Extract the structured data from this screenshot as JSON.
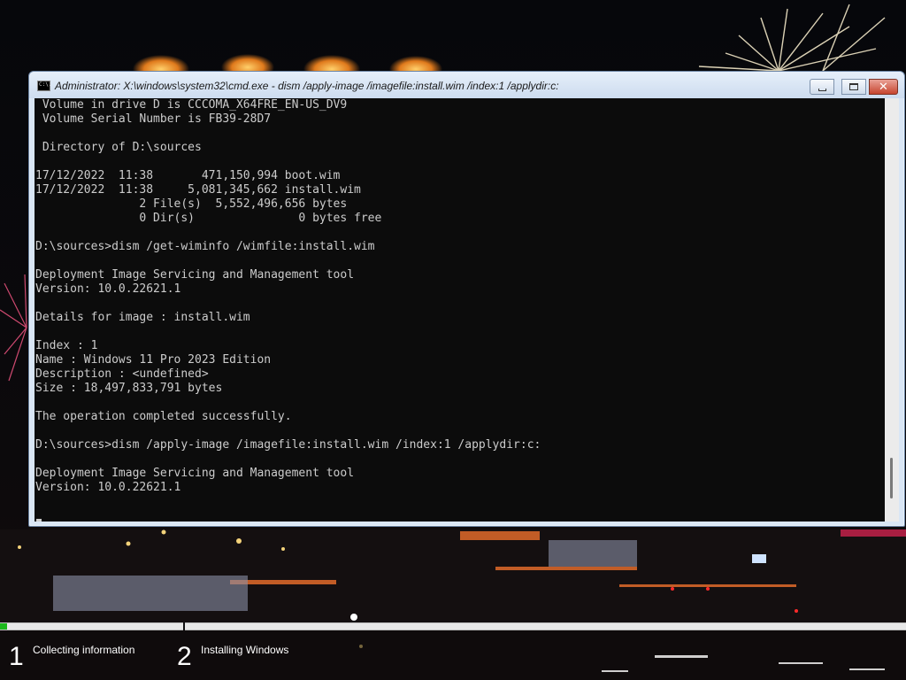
{
  "window": {
    "title": "Administrator: X:\\windows\\system32\\cmd.exe - dism  /apply-image /imagefile:install.wim /index:1 /applydir:c:",
    "icon": "cmd-icon",
    "icon_text": "C:\\."
  },
  "console": {
    "lines": [
      " Volume in drive D is CCCOMA_X64FRE_EN-US_DV9",
      " Volume Serial Number is FB39-28D7",
      "",
      " Directory of D:\\sources",
      "",
      "17/12/2022  11:38       471,150,994 boot.wim",
      "17/12/2022  11:38     5,081,345,662 install.wim",
      "               2 File(s)  5,552,496,656 bytes",
      "               0 Dir(s)               0 bytes free",
      "",
      "D:\\sources>dism /get-wiminfo /wimfile:install.wim",
      "",
      "Deployment Image Servicing and Management tool",
      "Version: 10.0.22621.1",
      "",
      "Details for image : install.wim",
      "",
      "Index : 1",
      "Name : Windows 11 Pro 2023 Edition",
      "Description : <undefined>",
      "Size : 18,497,833,791 bytes",
      "",
      "The operation completed successfully.",
      "",
      "D:\\sources>dism /apply-image /imagefile:install.wim /index:1 /applydir:c:",
      "",
      "Deployment Image Servicing and Management tool",
      "Version: 10.0.22621.1"
    ],
    "text_color": "#cccccc",
    "background": "#0c0c0c"
  },
  "setup": {
    "progress_fraction": 0.008,
    "progress_color": "#1bb81b",
    "steps": [
      {
        "number": "1",
        "label": "Collecting information"
      },
      {
        "number": "2",
        "label": "Installing Windows"
      }
    ]
  }
}
